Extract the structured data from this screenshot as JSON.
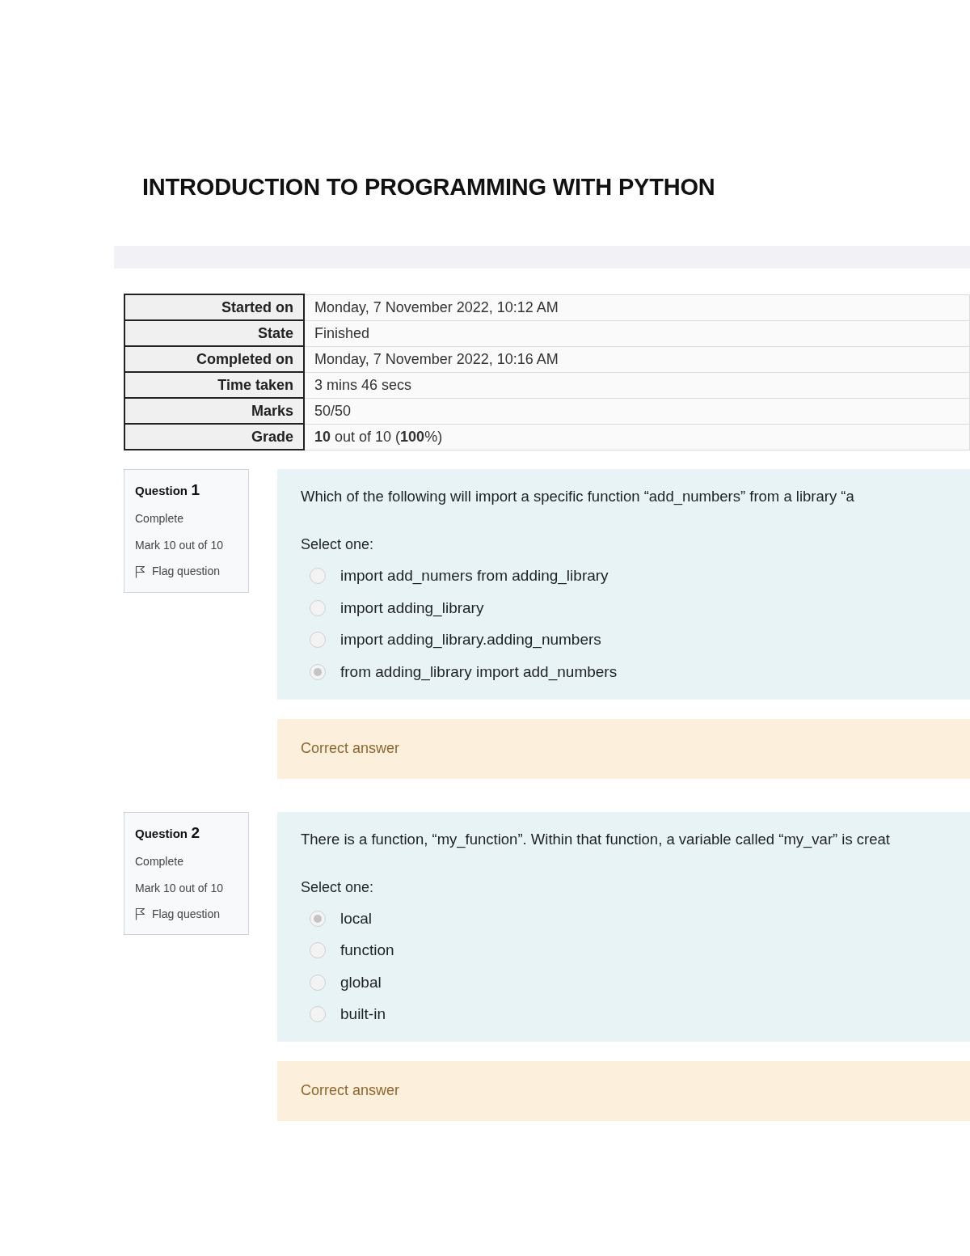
{
  "title": "INTRODUCTION TO PROGRAMMING WITH PYTHON",
  "summary": [
    {
      "label": "Started on",
      "value": "Monday, 7 November 2022, 10:12 AM"
    },
    {
      "label": "State",
      "value": "Finished"
    },
    {
      "label": "Completed on",
      "value": "Monday, 7 November 2022, 10:16 AM"
    },
    {
      "label": "Time taken",
      "value": "3 mins 46 secs"
    },
    {
      "label": "Marks",
      "value": "50/50"
    },
    {
      "label": "Grade",
      "value": "**10** out of 10 (**100**%)"
    }
  ],
  "questions": [
    {
      "label": "Question",
      "number": "1",
      "status": "Complete",
      "mark": "Mark 10 out of 10",
      "flag": "Flag question",
      "text": "Which of the following will import a specific function “add_numbers” from a library “a",
      "prompt": "Select one:",
      "options": [
        {
          "text": "import add_numers from adding_library",
          "selected": false
        },
        {
          "text": "import adding_library",
          "selected": false
        },
        {
          "text": "import adding_library.adding_numbers",
          "selected": false
        },
        {
          "text": "from adding_library import add_numbers",
          "selected": true
        }
      ],
      "feedback": "Correct answer"
    },
    {
      "label": "Question",
      "number": "2",
      "status": "Complete",
      "mark": "Mark 10 out of 10",
      "flag": "Flag question",
      "text": "There is a function, “my_function”. Within that function, a variable called “my_var” is creat",
      "prompt": "Select one:",
      "options": [
        {
          "text": "local",
          "selected": true
        },
        {
          "text": "function",
          "selected": false
        },
        {
          "text": "global",
          "selected": false
        },
        {
          "text": "built-in",
          "selected": false
        }
      ],
      "feedback": "Correct answer"
    }
  ]
}
